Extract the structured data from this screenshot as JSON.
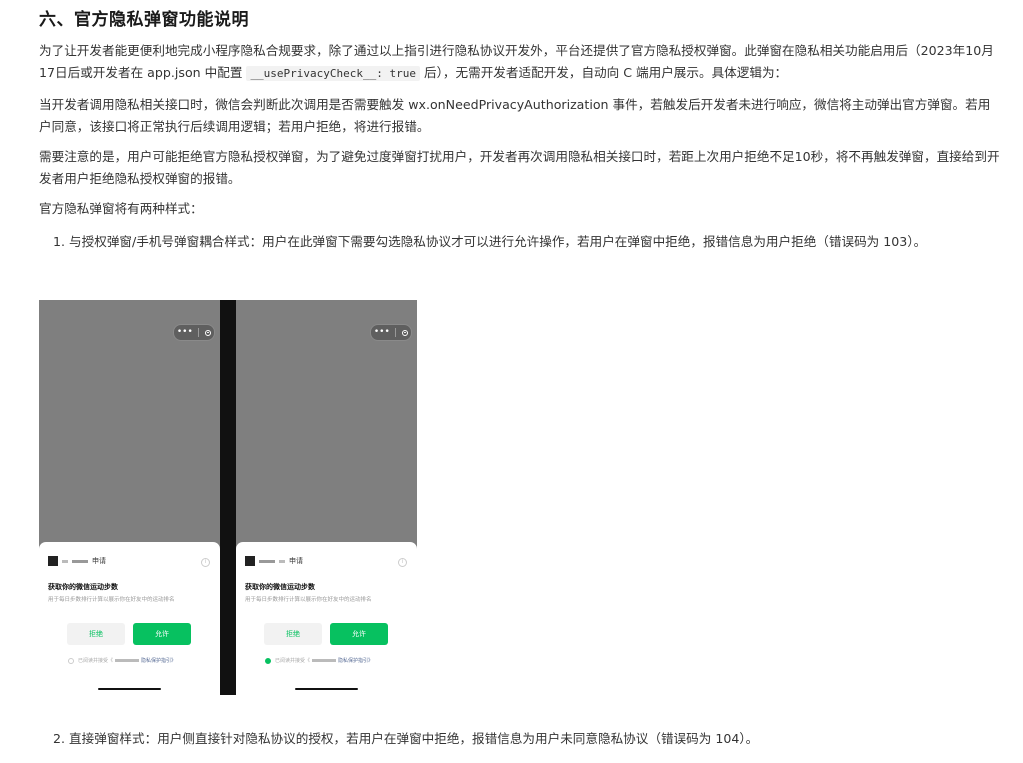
{
  "heading": "六、官方隐私弹窗功能说明",
  "para1": {
    "before": "为了让开发者能更便利地完成小程序隐私合规要求，除了通过以上指引进行隐私协议开发外，平台还提供了官方隐私授权弹窗。此弹窗在隐私相关功能启用后（2023年10月17日后或开发者在 app.json 中配置 ",
    "code": "__usePrivacyCheck__: true",
    "after": " 后），无需开发者适配开发，自动向 C 端用户展示。具体逻辑为："
  },
  "para2": "当开发者调用隐私相关接口时，微信会判断此次调用是否需要触发 wx.onNeedPrivacyAuthorization 事件，若触发后开发者未进行响应，微信将主动弹出官方弹窗。若用户同意，该接口将正常执行后续调用逻辑；若用户拒绝，将进行报错。",
  "para3": "需要注意的是，用户可能拒绝官方隐私授权弹窗，为了避免过度弹窗打扰用户，开发者再次调用隐私相关接口时，若距上次用户拒绝不足10秒，将不再触发弹窗，直接给到开发者用户拒绝隐私授权弹窗的报错。",
  "para4": "官方隐私弹窗将有两种样式：",
  "list": [
    {
      "num": "1.",
      "text": "与授权弹窗/手机号弹窗耦合样式：用户在此弹窗下需要勾选隐私协议才可以进行允许操作，若用户在弹窗中拒绝，报错信息为用户拒绝（错误码为 103）。"
    },
    {
      "num": "2.",
      "text": "直接弹窗样式：用户侧直接针对隐私协议的授权，若用户在弹窗中拒绝，报错信息为用户未同意隐私协议（错误码为 104）。"
    }
  ],
  "figure": {
    "capsule_dots": "•••",
    "apply_label": "申请",
    "info_glyph": "i",
    "sheet_title": "获取你的微信运动步数",
    "sheet_sub": "用于每日步数排行计算以展示你在好友中的运动排名",
    "reject_label": "拒绝",
    "allow_label": "允许",
    "consent_prefix": "已阅读并接受《",
    "consent_link": "隐私保护指引》",
    "accent": "#07c160"
  }
}
